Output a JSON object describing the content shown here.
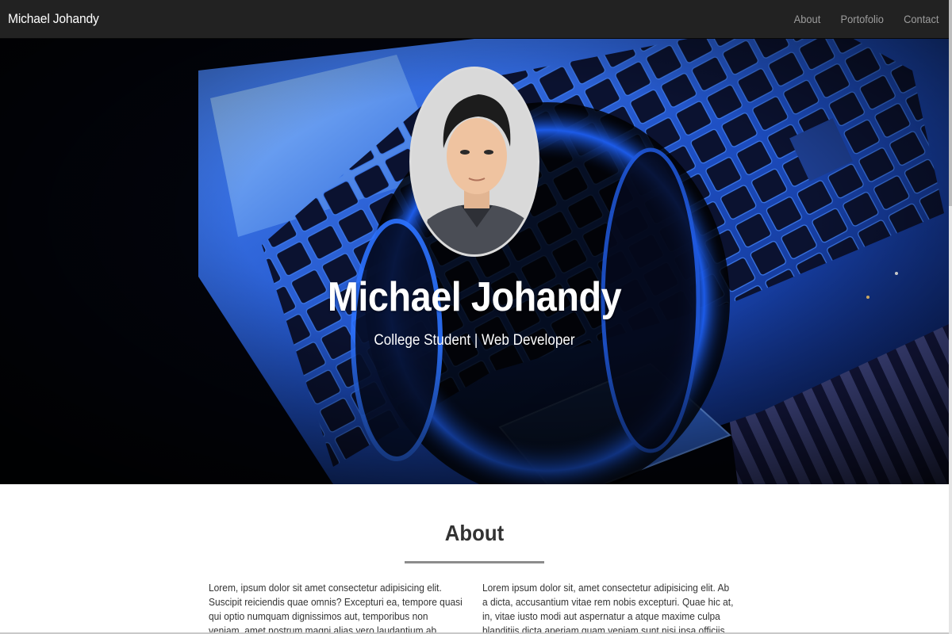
{
  "navbar": {
    "brand": "Michael Johandy",
    "links": [
      {
        "label": "About"
      },
      {
        "label": "Portofolio"
      },
      {
        "label": "Contact"
      }
    ]
  },
  "hero": {
    "title": "Michael Johandy",
    "subtitle": "College Student | Web Developer",
    "background_image": "laptop-with-headphones-blue-photo",
    "profile_image": "profile-photo"
  },
  "about": {
    "title": "About",
    "col_left": "Lorem, ipsum dolor sit amet consectetur adipisicing elit. Suscipit reiciendis quae omnis? Excepturi ea, tempore quasi qui optio numquam dignissimos aut, temporibus non veniam, amet nostrum magni alias vero laudantium ab beatae eveniet harum error accusamus est! Debitis.",
    "col_right": "Lorem ipsum dolor sit, amet consectetur adipisicing elit. Ab a dicta, accusantium vitae rem nobis excepturi. Quae hic at, in, vitae iusto modi aut aspernatur a atque maxime culpa blanditiis dicta aperiam quam veniam sunt nisi ipsa officiis esse. Assumenda, minima perspiciatis?"
  },
  "colors": {
    "navbar_bg": "#222222",
    "nav_link": "#9d9d9d",
    "hero_blue": "#1a5bd6"
  }
}
